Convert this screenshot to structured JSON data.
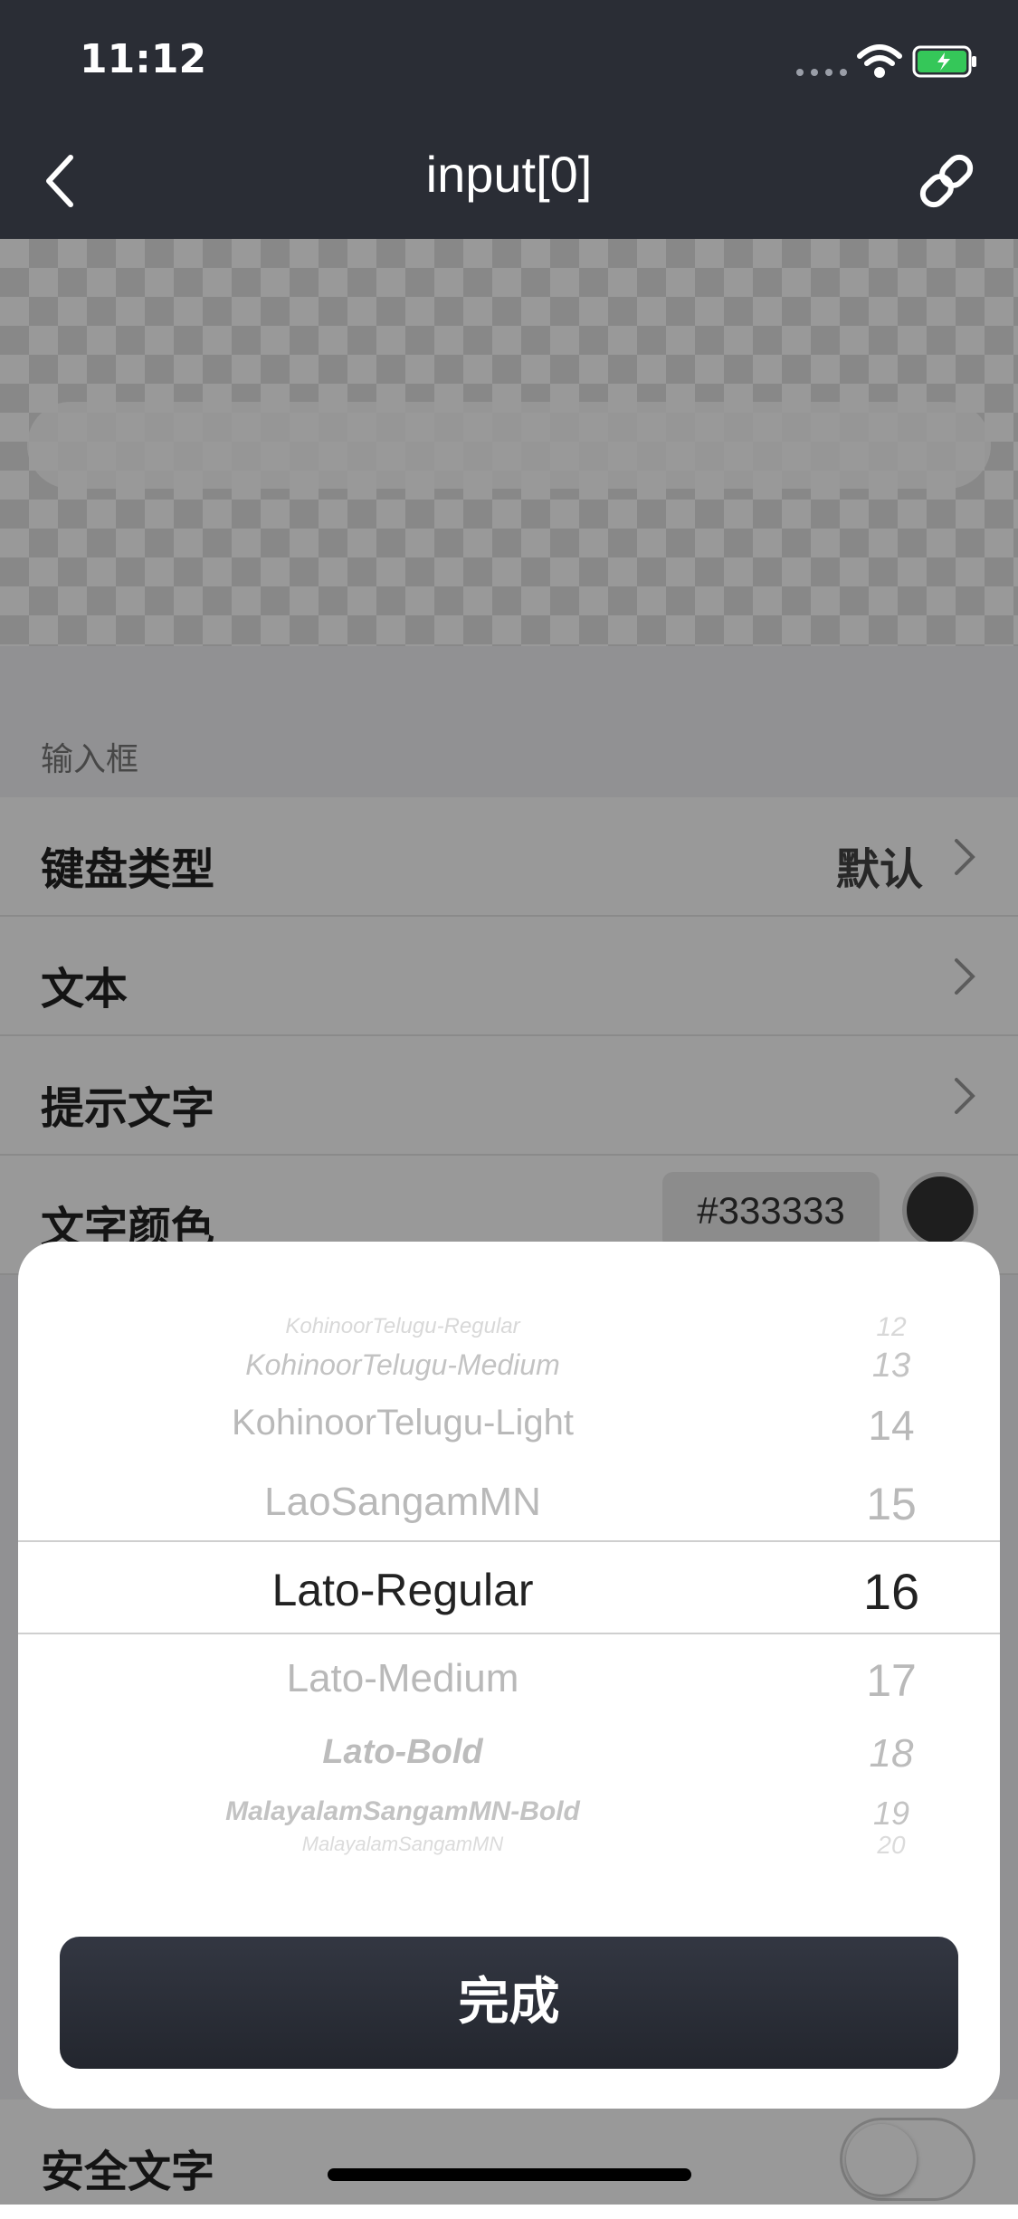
{
  "status_bar": {
    "time": "11:12"
  },
  "nav": {
    "title": "input[0]"
  },
  "section": {
    "label": "输入框"
  },
  "rows": [
    {
      "label": "键盘类型",
      "value": "默认"
    },
    {
      "label": "文本"
    },
    {
      "label": "提示文字"
    },
    {
      "label": "文字颜色",
      "value": "#333333",
      "color": "#333333"
    },
    {
      "label": "安全文字",
      "toggle": false
    }
  ],
  "picker": {
    "fonts": [
      "KohinoorTelugu-Regular",
      "KohinoorTelugu-Medium",
      "KohinoorTelugu-Light",
      "LaoSangamMN",
      "Lato-Regular",
      "Lato-Medium",
      "Lato-Bold",
      "MalayalamSangamMN-Bold",
      "MalayalamSangamMN"
    ],
    "sizes": [
      "12",
      "13",
      "14",
      "15",
      "16",
      "17",
      "18",
      "19",
      "20"
    ],
    "selected_font": "Lato-Regular",
    "selected_size": "16"
  },
  "done_label": "完成"
}
